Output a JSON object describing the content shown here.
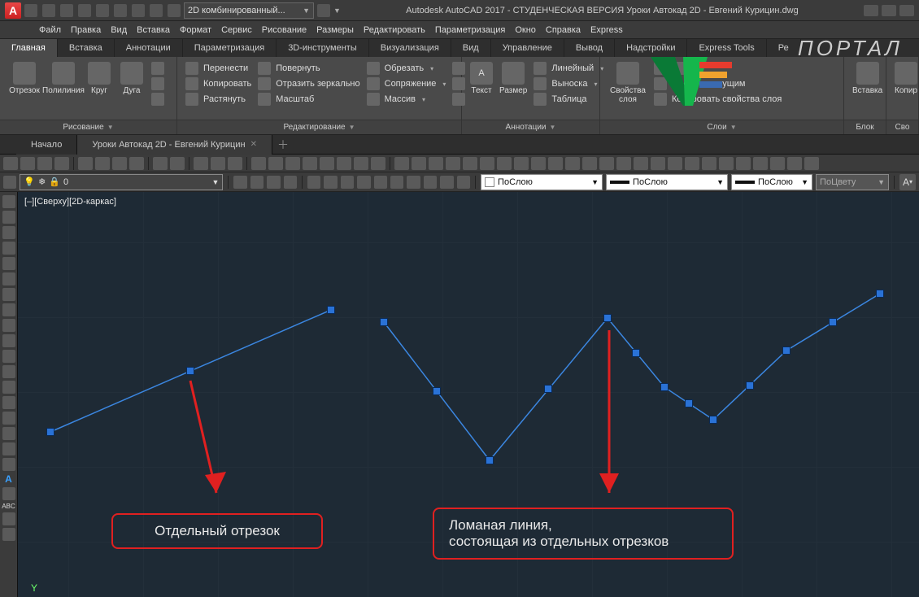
{
  "titlebar": {
    "workspace_combo": "2D комбинированный...",
    "title_text": "Autodesk AutoCAD 2017 - СТУДЕНЧЕСКАЯ ВЕРСИЯ   Уроки Автокад 2D - Евгений Курицин.dwg"
  },
  "menu": [
    "Файл",
    "Правка",
    "Вид",
    "Вставка",
    "Формат",
    "Сервис",
    "Рисование",
    "Размеры",
    "Редактировать",
    "Параметризация",
    "Окно",
    "Справка",
    "Express"
  ],
  "ribbon_tabs": [
    "Главная",
    "Вставка",
    "Аннотации",
    "Параметризация",
    "3D-инструменты",
    "Визуализация",
    "Вид",
    "Управление",
    "Вывод",
    "Надстройки",
    "Express Tools",
    "Ре"
  ],
  "ribbon_active": 0,
  "ribbon": {
    "draw": {
      "title": "Рисование",
      "buttons": [
        "Отрезок",
        "Полилиния",
        "Круг",
        "Дуга"
      ]
    },
    "edit": {
      "title": "Редактирование",
      "col1": [
        "Перенести",
        "Копировать",
        "Растянуть"
      ],
      "col2": [
        "Повернуть",
        "Отразить зеркально",
        "Масштаб"
      ],
      "col3": [
        "Обрезать",
        "Сопряжение",
        "Массив"
      ]
    },
    "annot": {
      "title": "Аннотации",
      "text": "Текст",
      "dim": "Размер",
      "col": [
        "Линейный",
        "Выноска",
        "Таблица"
      ]
    },
    "layers": {
      "title": "Слои",
      "props": "Свойства слоя",
      "row2": "Сделать текущим",
      "row3": "Копировать свойства слоя"
    },
    "block": {
      "title": "Блок",
      "insert": "Вставка"
    },
    "props": {
      "title": "Сво",
      "copy": "Копир"
    }
  },
  "doctabs": {
    "home": "Начало",
    "active": "Уроки Автокад 2D - Евгений Курицин"
  },
  "layer_selectors": {
    "layer": "0",
    "bylayer1": "ПоСлою",
    "bylayer2": "ПоСлою",
    "bylayer3": "ПоСлою",
    "bycolor": "ПоЦвету"
  },
  "canvas": {
    "view_label": "[–][Сверху][2D-каркас]",
    "axis_y": "Y"
  },
  "callouts": {
    "left": "Отдельный отрезок",
    "right_l1": "Ломаная линия,",
    "right_l2": "состоящая из отдельных отрезков"
  },
  "portal_text": "ПОРТАЛ"
}
